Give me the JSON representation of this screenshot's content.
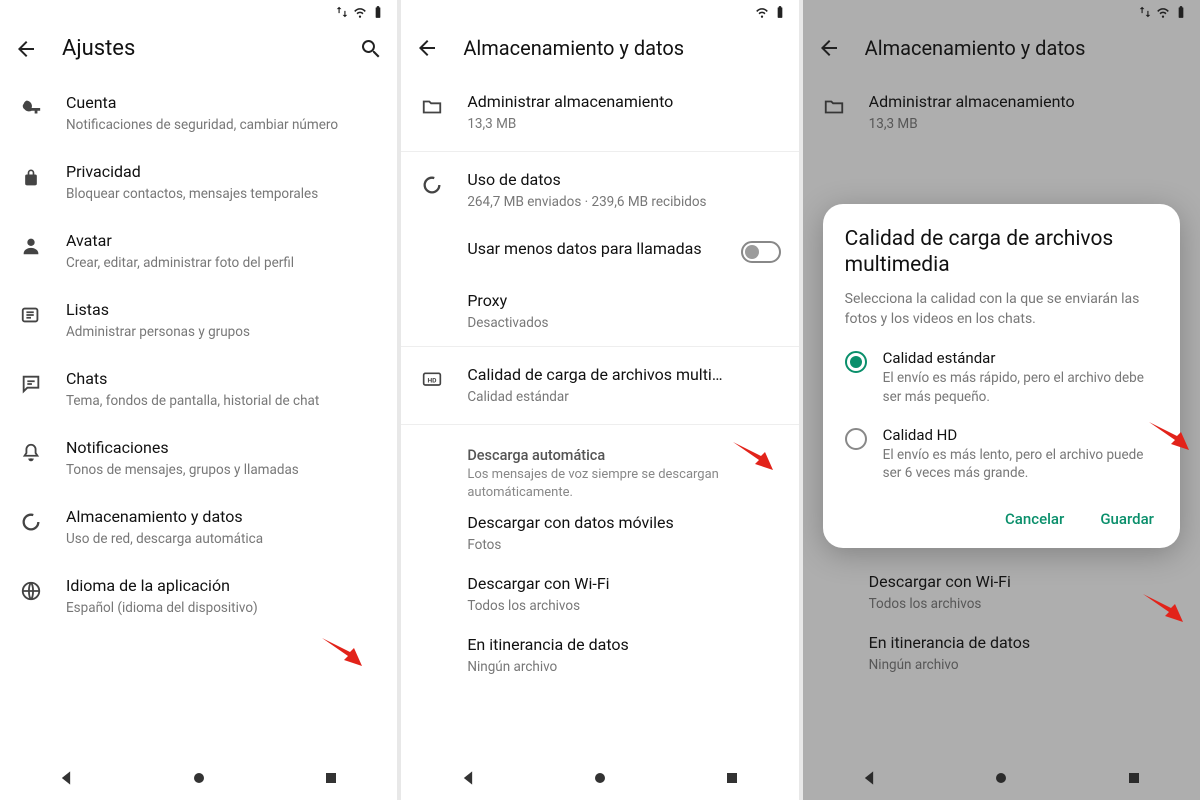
{
  "screen1": {
    "title": "Ajustes",
    "items": [
      {
        "label": "Cuenta",
        "sub": "Notificaciones de seguridad, cambiar número"
      },
      {
        "label": "Privacidad",
        "sub": "Bloquear contactos, mensajes temporales"
      },
      {
        "label": "Avatar",
        "sub": "Crear, editar, administrar foto del perfil"
      },
      {
        "label": "Listas",
        "sub": "Administrar personas y grupos"
      },
      {
        "label": "Chats",
        "sub": "Tema, fondos de pantalla, historial de chat"
      },
      {
        "label": "Notificaciones",
        "sub": "Tonos de mensajes, grupos y llamadas"
      },
      {
        "label": "Almacenamiento y datos",
        "sub": "Uso de red, descarga automática"
      },
      {
        "label": "Idioma de la aplicación",
        "sub": "Español (idioma del dispositivo)"
      }
    ]
  },
  "screen2": {
    "title": "Almacenamiento y datos",
    "storage": {
      "label": "Administrar almacenamiento",
      "sub": "13,3 MB"
    },
    "usage": {
      "label": "Uso de datos",
      "sub": "264,7 MB enviados · 239,6 MB recibidos"
    },
    "less_data": {
      "label": "Usar menos datos para llamadas"
    },
    "proxy": {
      "label": "Proxy",
      "sub": "Desactivados"
    },
    "upload_quality": {
      "label": "Calidad de carga de archivos multi…",
      "sub": "Calidad estándar"
    },
    "auto_dl_header": {
      "title": "Descarga automática",
      "sub": "Los mensajes de voz siempre se descargan automáticamente."
    },
    "dl_mobile": {
      "label": "Descargar con datos móviles",
      "sub": "Fotos"
    },
    "dl_wifi": {
      "label": "Descargar con Wi-Fi",
      "sub": "Todos los archivos"
    },
    "dl_roaming": {
      "label": "En itinerancia de datos",
      "sub": "Ningún archivo"
    }
  },
  "dialog": {
    "title": "Calidad de carga de archivos multimedia",
    "sub": "Selecciona la calidad con la que se enviarán las fotos y los videos en los chats.",
    "opt_std": {
      "label": "Calidad estándar",
      "sub": "El envío es más rápido, pero el archivo debe ser más pequeño."
    },
    "opt_hd": {
      "label": "Calidad HD",
      "sub": "El envío es más lento, pero el archivo puede ser 6 veces más grande."
    },
    "cancel": "Cancelar",
    "save": "Guardar"
  }
}
